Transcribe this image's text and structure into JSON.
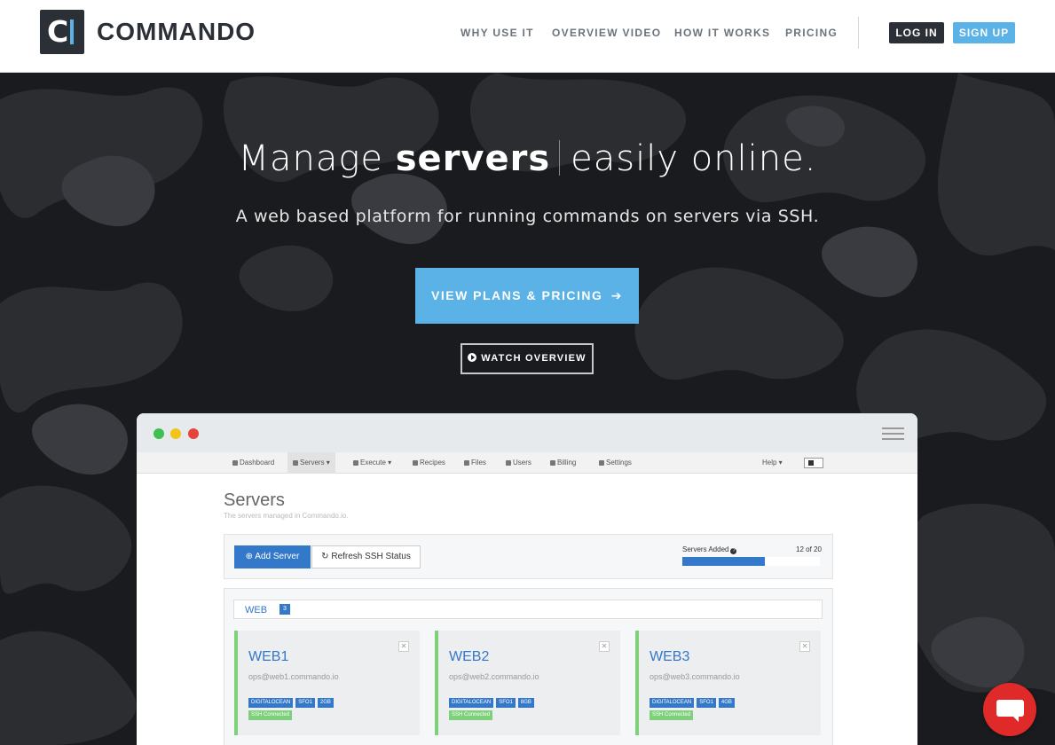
{
  "brand": {
    "logo_letter": "C",
    "name": "COMMANDO",
    "color": "#5ab2e6",
    "dark": "#2b2f36"
  },
  "nav": {
    "links": [
      "WHY USE IT",
      "OVERVIEW VIDEO",
      "HOW IT WORKS",
      "PRICING"
    ],
    "login": "LOG IN",
    "signup": "SIGN UP"
  },
  "hero": {
    "headline_pre": "Manage ",
    "headline_bold": "servers",
    "headline_post": "easily online.",
    "subline": "A web based platform for running commands on servers via SSH.",
    "cta": "VIEW PLANS & PRICING",
    "cta_arrow": "➔",
    "watch": "WATCH OVERVIEW"
  },
  "app": {
    "window_dots": [
      "#3fbf4f",
      "#f2c318",
      "#e5433b"
    ],
    "nav": [
      "Dashboard",
      "Servers ▾",
      "Execute ▾",
      "Recipes",
      "Files",
      "Users",
      "Billing",
      "Settings"
    ],
    "help": "Help ▾",
    "title": "Servers",
    "subtitle": "The servers managed in Commando.io.",
    "add_server": "Add Server",
    "refresh": "Refresh SSH Status",
    "servers_added_label": "Servers Added",
    "servers_added_count": "12 of 20",
    "servers_added_fraction": 0.6,
    "group": {
      "name": "WEB",
      "count": "3"
    },
    "cards": [
      {
        "name": "WEB1",
        "host": "ops@web1.commando.io",
        "tags": [
          "DIGITALOCEAN",
          "SFO1",
          "2GB"
        ],
        "status": "SSH Connected"
      },
      {
        "name": "WEB2",
        "host": "ops@web2.commando.io",
        "tags": [
          "DIGITALOCEAN",
          "SFO1",
          "8GB"
        ],
        "status": "SSH Connected"
      },
      {
        "name": "WEB3",
        "host": "ops@web3.commando.io",
        "tags": [
          "DIGITALOCEAN",
          "SFO1",
          "4GB"
        ],
        "status": "SSH Connected"
      }
    ]
  }
}
